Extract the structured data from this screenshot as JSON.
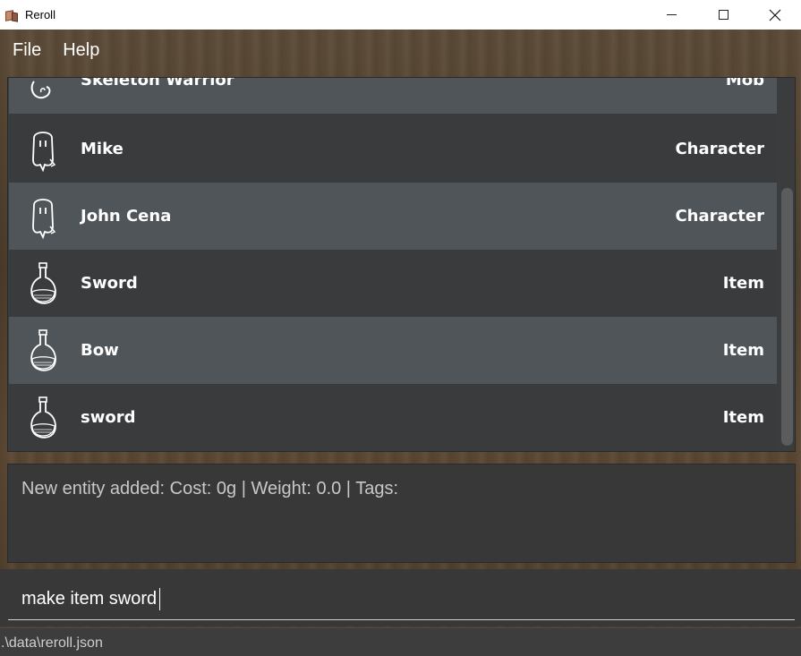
{
  "window": {
    "title": "Reroll",
    "controls": [
      "minimize",
      "maximize",
      "close"
    ]
  },
  "menu": {
    "items": [
      "File",
      "Help"
    ]
  },
  "entities": [
    {
      "name": "Skeleton Warrior",
      "type": "Mob",
      "icon": "skeleton-icon"
    },
    {
      "name": "Mike",
      "type": "Character",
      "icon": "ghost-character-icon"
    },
    {
      "name": "John Cena",
      "type": "Character",
      "icon": "ghost-character-icon"
    },
    {
      "name": "Sword",
      "type": "Item",
      "icon": "potion-flask-icon"
    },
    {
      "name": "Bow",
      "type": "Item",
      "icon": "potion-flask-icon"
    },
    {
      "name": "sword",
      "type": "Item",
      "icon": "potion-flask-icon"
    }
  ],
  "result": {
    "text": "New entity added: Cost: 0g | Weight: 0.0 | Tags:"
  },
  "command": {
    "value": "make item sword"
  },
  "status": {
    "path": ".\\data\\reroll.json"
  },
  "colors": {
    "row_light": "#4f5559",
    "row_dark": "#3a3b3d",
    "panel": "#383838"
  }
}
